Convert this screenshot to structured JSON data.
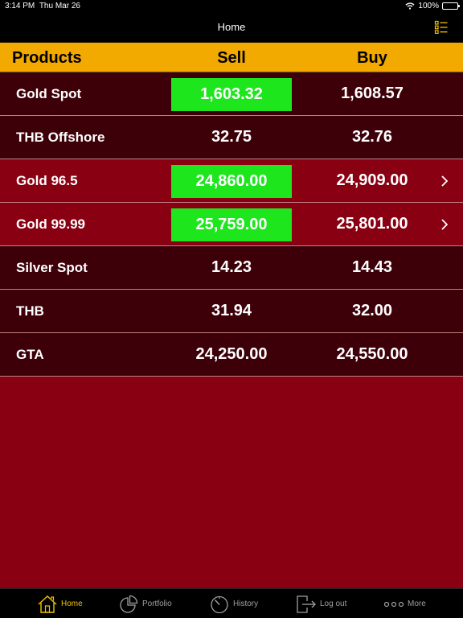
{
  "status": {
    "time": "3:14 PM",
    "date": "Thu Mar 26",
    "battery": "100%"
  },
  "nav": {
    "title": "Home",
    "menu_icon": "list-icon"
  },
  "table": {
    "headers": [
      "Products",
      "Sell",
      "Buy"
    ],
    "rows": [
      {
        "name": "Gold Spot",
        "sell": "1,603.32",
        "buy": "1,608.57",
        "sell_highlight": true,
        "has_chevron": false
      },
      {
        "name": "THB Offshore",
        "sell": "32.75",
        "buy": "32.76",
        "sell_highlight": false,
        "has_chevron": false
      },
      {
        "name": "Gold 96.5",
        "sell": "24,860.00",
        "buy": "24,909.00",
        "sell_highlight": true,
        "has_chevron": true
      },
      {
        "name": "Gold 99.99",
        "sell": "25,759.00",
        "buy": "25,801.00",
        "sell_highlight": true,
        "has_chevron": true
      },
      {
        "name": "Silver Spot",
        "sell": "14.23",
        "buy": "14.43",
        "sell_highlight": false,
        "has_chevron": false
      },
      {
        "name": "THB",
        "sell": "31.94",
        "buy": "32.00",
        "sell_highlight": false,
        "has_chevron": false
      },
      {
        "name": "GTA",
        "sell": "24,250.00",
        "buy": "24,550.00",
        "sell_highlight": false,
        "has_chevron": false
      }
    ]
  },
  "tabs": [
    {
      "label": "Home",
      "icon": "home-icon",
      "active": true
    },
    {
      "label": "Portfolio",
      "icon": "pie-chart-icon",
      "active": false
    },
    {
      "label": "History",
      "icon": "gauge-icon",
      "active": false
    },
    {
      "label": "Log out",
      "icon": "logout-icon",
      "active": false
    },
    {
      "label": "More",
      "icon": "more-dots-icon",
      "active": false
    }
  ],
  "colors": {
    "header": "#f2a900",
    "highlight": "#1de61d",
    "dark_row": "#3d0009",
    "red_row": "#8a0013",
    "active_tab": "#f2c200"
  }
}
